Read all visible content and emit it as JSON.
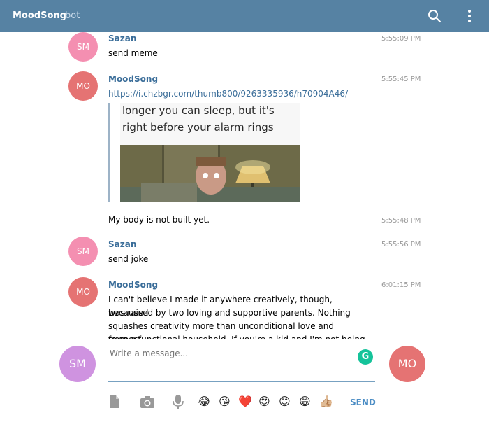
{
  "header": {
    "title": "MoodSong",
    "subtitle": "bot"
  },
  "messages": [
    {
      "initials": "SM",
      "author": "Sazan",
      "time": "5:55:09 PM",
      "text": "send meme"
    },
    {
      "initials": "MO",
      "author": "MoodSong",
      "time": "5:55:45 PM",
      "link": "https://i.chzbgr.com/thumb800/9263335936/h70904A46/",
      "preview_caption_1": "longer you can sleep, but it's",
      "preview_caption_2": "right before your alarm rings"
    },
    {
      "time": "5:55:48 PM",
      "text": "My body is not built yet."
    },
    {
      "initials": "SM",
      "author": "Sazan",
      "time": "5:55:56 PM",
      "text": "send joke"
    },
    {
      "initials": "MO",
      "author": "MoodSong",
      "time": "6:01:15 PM",
      "text_lines": [
        "I can't believe I made it anywhere creatively, though, because I",
        "was raised by two loving and supportive parents. Nothing",
        "squashes creativity more than unconditional love and support",
        "from a functional household. If you're a kid and I'm not being"
      ]
    }
  ],
  "composer": {
    "placeholder": "Write a message...",
    "left_avatar": "SM",
    "right_avatar": "MO",
    "send_label": "SEND",
    "emojis": [
      "😂",
      "😘",
      "❤️",
      "😍",
      "😊",
      "😁",
      "👍🏼"
    ]
  },
  "colors": {
    "header": "#5682a3",
    "link": "#3a6d99",
    "send": "#4a8cc4",
    "avatar_sm_big": "#cf93e0",
    "avatar_mo": "#e57373"
  }
}
